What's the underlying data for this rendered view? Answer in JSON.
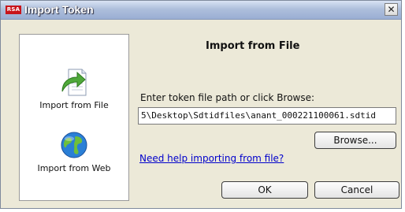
{
  "window": {
    "app_badge": "RSA",
    "title": "Import Token",
    "close_symbol": "✕"
  },
  "sidebar": {
    "items": [
      {
        "label": "Import from File",
        "icon": "import-file-icon"
      },
      {
        "label": "Import from Web",
        "icon": "globe-icon"
      }
    ]
  },
  "main": {
    "title": "Import from File",
    "prompt": "Enter token file path or click Browse:",
    "path_value": "5\\Desktop\\Sdtidfiles\\anant_000221100061.sdtid",
    "browse_label": "Browse...",
    "help_link": "Need help importing from file?",
    "ok_label": "OK",
    "cancel_label": "Cancel"
  },
  "colors": {
    "title_bar": "#aebfdc",
    "badge": "#c8141a",
    "link": "#0000cc",
    "dialog_bg": "#ece9d8"
  }
}
